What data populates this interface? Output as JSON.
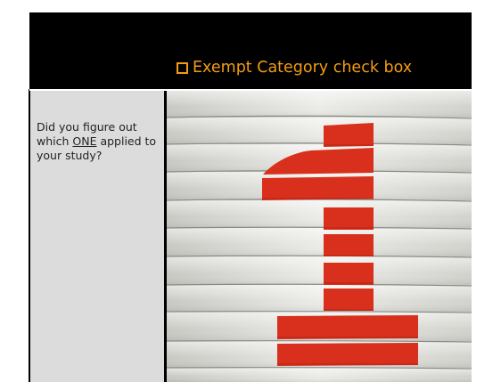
{
  "header": {
    "title": "Exempt Category check box"
  },
  "left_cell": {
    "text_before": "Did you figure out which ",
    "emphasis": "ONE",
    "text_after": " applied to your study?"
  },
  "photo": {
    "icon": "number-one-photo"
  },
  "colors": {
    "header_bg": "#000000",
    "accent": "#f39c12",
    "left_cell_bg": "#dcdcdc",
    "numeral_red": "#d8301c"
  }
}
